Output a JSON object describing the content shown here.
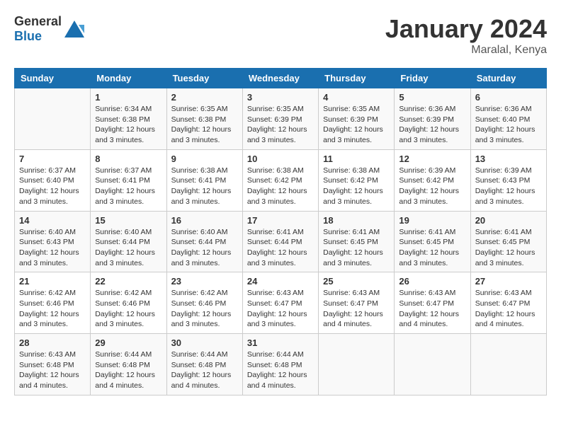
{
  "header": {
    "logo_general": "General",
    "logo_blue": "Blue",
    "month_year": "January 2024",
    "location": "Maralal, Kenya"
  },
  "weekdays": [
    "Sunday",
    "Monday",
    "Tuesday",
    "Wednesday",
    "Thursday",
    "Friday",
    "Saturday"
  ],
  "weeks": [
    [
      {
        "day": "",
        "sunrise": "",
        "sunset": "",
        "daylight": ""
      },
      {
        "day": "1",
        "sunrise": "Sunrise: 6:34 AM",
        "sunset": "Sunset: 6:38 PM",
        "daylight": "Daylight: 12 hours and 3 minutes."
      },
      {
        "day": "2",
        "sunrise": "Sunrise: 6:35 AM",
        "sunset": "Sunset: 6:38 PM",
        "daylight": "Daylight: 12 hours and 3 minutes."
      },
      {
        "day": "3",
        "sunrise": "Sunrise: 6:35 AM",
        "sunset": "Sunset: 6:39 PM",
        "daylight": "Daylight: 12 hours and 3 minutes."
      },
      {
        "day": "4",
        "sunrise": "Sunrise: 6:35 AM",
        "sunset": "Sunset: 6:39 PM",
        "daylight": "Daylight: 12 hours and 3 minutes."
      },
      {
        "day": "5",
        "sunrise": "Sunrise: 6:36 AM",
        "sunset": "Sunset: 6:39 PM",
        "daylight": "Daylight: 12 hours and 3 minutes."
      },
      {
        "day": "6",
        "sunrise": "Sunrise: 6:36 AM",
        "sunset": "Sunset: 6:40 PM",
        "daylight": "Daylight: 12 hours and 3 minutes."
      }
    ],
    [
      {
        "day": "7",
        "sunrise": "Sunrise: 6:37 AM",
        "sunset": "Sunset: 6:40 PM",
        "daylight": "Daylight: 12 hours and 3 minutes."
      },
      {
        "day": "8",
        "sunrise": "Sunrise: 6:37 AM",
        "sunset": "Sunset: 6:41 PM",
        "daylight": "Daylight: 12 hours and 3 minutes."
      },
      {
        "day": "9",
        "sunrise": "Sunrise: 6:38 AM",
        "sunset": "Sunset: 6:41 PM",
        "daylight": "Daylight: 12 hours and 3 minutes."
      },
      {
        "day": "10",
        "sunrise": "Sunrise: 6:38 AM",
        "sunset": "Sunset: 6:42 PM",
        "daylight": "Daylight: 12 hours and 3 minutes."
      },
      {
        "day": "11",
        "sunrise": "Sunrise: 6:38 AM",
        "sunset": "Sunset: 6:42 PM",
        "daylight": "Daylight: 12 hours and 3 minutes."
      },
      {
        "day": "12",
        "sunrise": "Sunrise: 6:39 AM",
        "sunset": "Sunset: 6:42 PM",
        "daylight": "Daylight: 12 hours and 3 minutes."
      },
      {
        "day": "13",
        "sunrise": "Sunrise: 6:39 AM",
        "sunset": "Sunset: 6:43 PM",
        "daylight": "Daylight: 12 hours and 3 minutes."
      }
    ],
    [
      {
        "day": "14",
        "sunrise": "Sunrise: 6:40 AM",
        "sunset": "Sunset: 6:43 PM",
        "daylight": "Daylight: 12 hours and 3 minutes."
      },
      {
        "day": "15",
        "sunrise": "Sunrise: 6:40 AM",
        "sunset": "Sunset: 6:44 PM",
        "daylight": "Daylight: 12 hours and 3 minutes."
      },
      {
        "day": "16",
        "sunrise": "Sunrise: 6:40 AM",
        "sunset": "Sunset: 6:44 PM",
        "daylight": "Daylight: 12 hours and 3 minutes."
      },
      {
        "day": "17",
        "sunrise": "Sunrise: 6:41 AM",
        "sunset": "Sunset: 6:44 PM",
        "daylight": "Daylight: 12 hours and 3 minutes."
      },
      {
        "day": "18",
        "sunrise": "Sunrise: 6:41 AM",
        "sunset": "Sunset: 6:45 PM",
        "daylight": "Daylight: 12 hours and 3 minutes."
      },
      {
        "day": "19",
        "sunrise": "Sunrise: 6:41 AM",
        "sunset": "Sunset: 6:45 PM",
        "daylight": "Daylight: 12 hours and 3 minutes."
      },
      {
        "day": "20",
        "sunrise": "Sunrise: 6:41 AM",
        "sunset": "Sunset: 6:45 PM",
        "daylight": "Daylight: 12 hours and 3 minutes."
      }
    ],
    [
      {
        "day": "21",
        "sunrise": "Sunrise: 6:42 AM",
        "sunset": "Sunset: 6:46 PM",
        "daylight": "Daylight: 12 hours and 3 minutes."
      },
      {
        "day": "22",
        "sunrise": "Sunrise: 6:42 AM",
        "sunset": "Sunset: 6:46 PM",
        "daylight": "Daylight: 12 hours and 3 minutes."
      },
      {
        "day": "23",
        "sunrise": "Sunrise: 6:42 AM",
        "sunset": "Sunset: 6:46 PM",
        "daylight": "Daylight: 12 hours and 3 minutes."
      },
      {
        "day": "24",
        "sunrise": "Sunrise: 6:43 AM",
        "sunset": "Sunset: 6:47 PM",
        "daylight": "Daylight: 12 hours and 3 minutes."
      },
      {
        "day": "25",
        "sunrise": "Sunrise: 6:43 AM",
        "sunset": "Sunset: 6:47 PM",
        "daylight": "Daylight: 12 hours and 4 minutes."
      },
      {
        "day": "26",
        "sunrise": "Sunrise: 6:43 AM",
        "sunset": "Sunset: 6:47 PM",
        "daylight": "Daylight: 12 hours and 4 minutes."
      },
      {
        "day": "27",
        "sunrise": "Sunrise: 6:43 AM",
        "sunset": "Sunset: 6:47 PM",
        "daylight": "Daylight: 12 hours and 4 minutes."
      }
    ],
    [
      {
        "day": "28",
        "sunrise": "Sunrise: 6:43 AM",
        "sunset": "Sunset: 6:48 PM",
        "daylight": "Daylight: 12 hours and 4 minutes."
      },
      {
        "day": "29",
        "sunrise": "Sunrise: 6:44 AM",
        "sunset": "Sunset: 6:48 PM",
        "daylight": "Daylight: 12 hours and 4 minutes."
      },
      {
        "day": "30",
        "sunrise": "Sunrise: 6:44 AM",
        "sunset": "Sunset: 6:48 PM",
        "daylight": "Daylight: 12 hours and 4 minutes."
      },
      {
        "day": "31",
        "sunrise": "Sunrise: 6:44 AM",
        "sunset": "Sunset: 6:48 PM",
        "daylight": "Daylight: 12 hours and 4 minutes."
      },
      {
        "day": "",
        "sunrise": "",
        "sunset": "",
        "daylight": ""
      },
      {
        "day": "",
        "sunrise": "",
        "sunset": "",
        "daylight": ""
      },
      {
        "day": "",
        "sunrise": "",
        "sunset": "",
        "daylight": ""
      }
    ]
  ]
}
